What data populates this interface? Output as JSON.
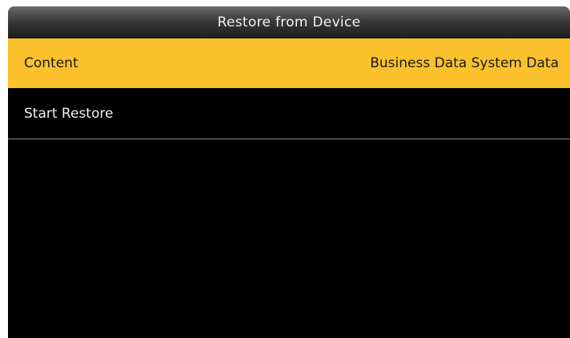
{
  "header": {
    "title": "Restore from Device"
  },
  "menu": {
    "content": {
      "label": "Content",
      "value": "Business Data System Data"
    },
    "start_restore": {
      "label": "Start Restore"
    }
  },
  "colors": {
    "highlight": "#fbc12c",
    "background": "#000000",
    "title_bar": "#3a3a3a",
    "text_light": "#f0f0f0",
    "text_dark": "#1a1a1a"
  }
}
